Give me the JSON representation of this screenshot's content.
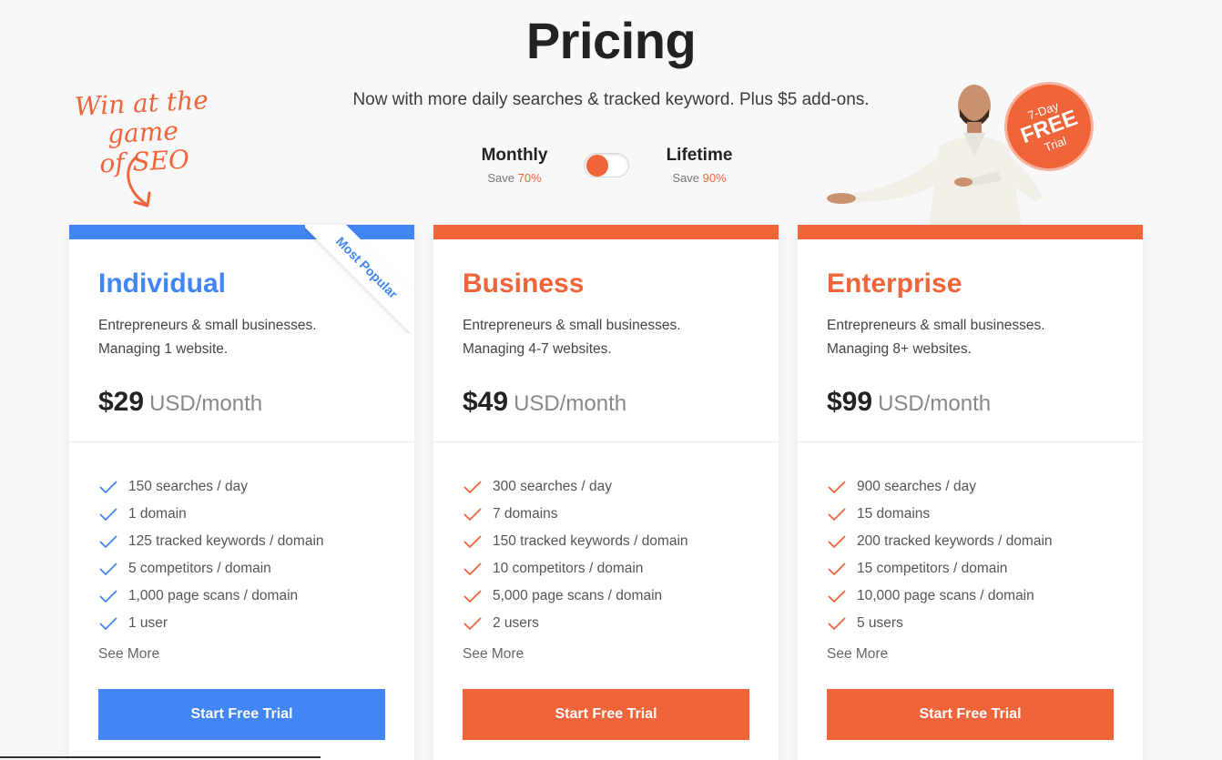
{
  "header": {
    "title": "Pricing",
    "subtitle": "Now with more daily searches & tracked keyword. Plus $5 add-ons."
  },
  "hand_note": {
    "line1": "Win at the game",
    "line2": "of SEO"
  },
  "billing": {
    "monthly": {
      "label": "Monthly",
      "save_prefix": "Save",
      "save_pct": "70%"
    },
    "lifetime": {
      "label": "Lifetime",
      "save_prefix": "Save",
      "save_pct": "90%"
    },
    "selected": "Monthly"
  },
  "trial_badge": {
    "line1": "7-Day",
    "line2": "FREE",
    "line3": "Trial"
  },
  "colors": {
    "accent_orange": "#f0643a",
    "accent_blue": "#4285f4"
  },
  "plans": [
    {
      "name": "Individual",
      "ribbon": "Most Popular",
      "desc_line1": "Entrepreneurs & small businesses.",
      "desc_line2": "Managing 1 website.",
      "price": "$29",
      "period": "USD/month",
      "features": [
        "150 searches / day",
        "1 domain",
        "125 tracked keywords / domain",
        "5 competitors / domain",
        "1,000 page scans / domain",
        "1 user"
      ],
      "see_more": "See More",
      "cta": "Start Free Trial"
    },
    {
      "name": "Business",
      "desc_line1": "Entrepreneurs & small businesses.",
      "desc_line2": "Managing 4-7 websites.",
      "price": "$49",
      "period": "USD/month",
      "features": [
        "300 searches / day",
        "7 domains",
        "150 tracked keywords / domain",
        "10 competitors / domain",
        "5,000 page scans / domain",
        "2 users"
      ],
      "see_more": "See More",
      "cta": "Start Free Trial"
    },
    {
      "name": "Enterprise",
      "desc_line1": "Entrepreneurs & small businesses.",
      "desc_line2": "Managing 8+ websites.",
      "price": "$99",
      "period": "USD/month",
      "features": [
        "900 searches / day",
        "15 domains",
        "200 tracked keywords / domain",
        "15 competitors / domain",
        "10,000 page scans / domain",
        "5 users"
      ],
      "see_more": "See More",
      "cta": "Start Free Trial"
    }
  ]
}
